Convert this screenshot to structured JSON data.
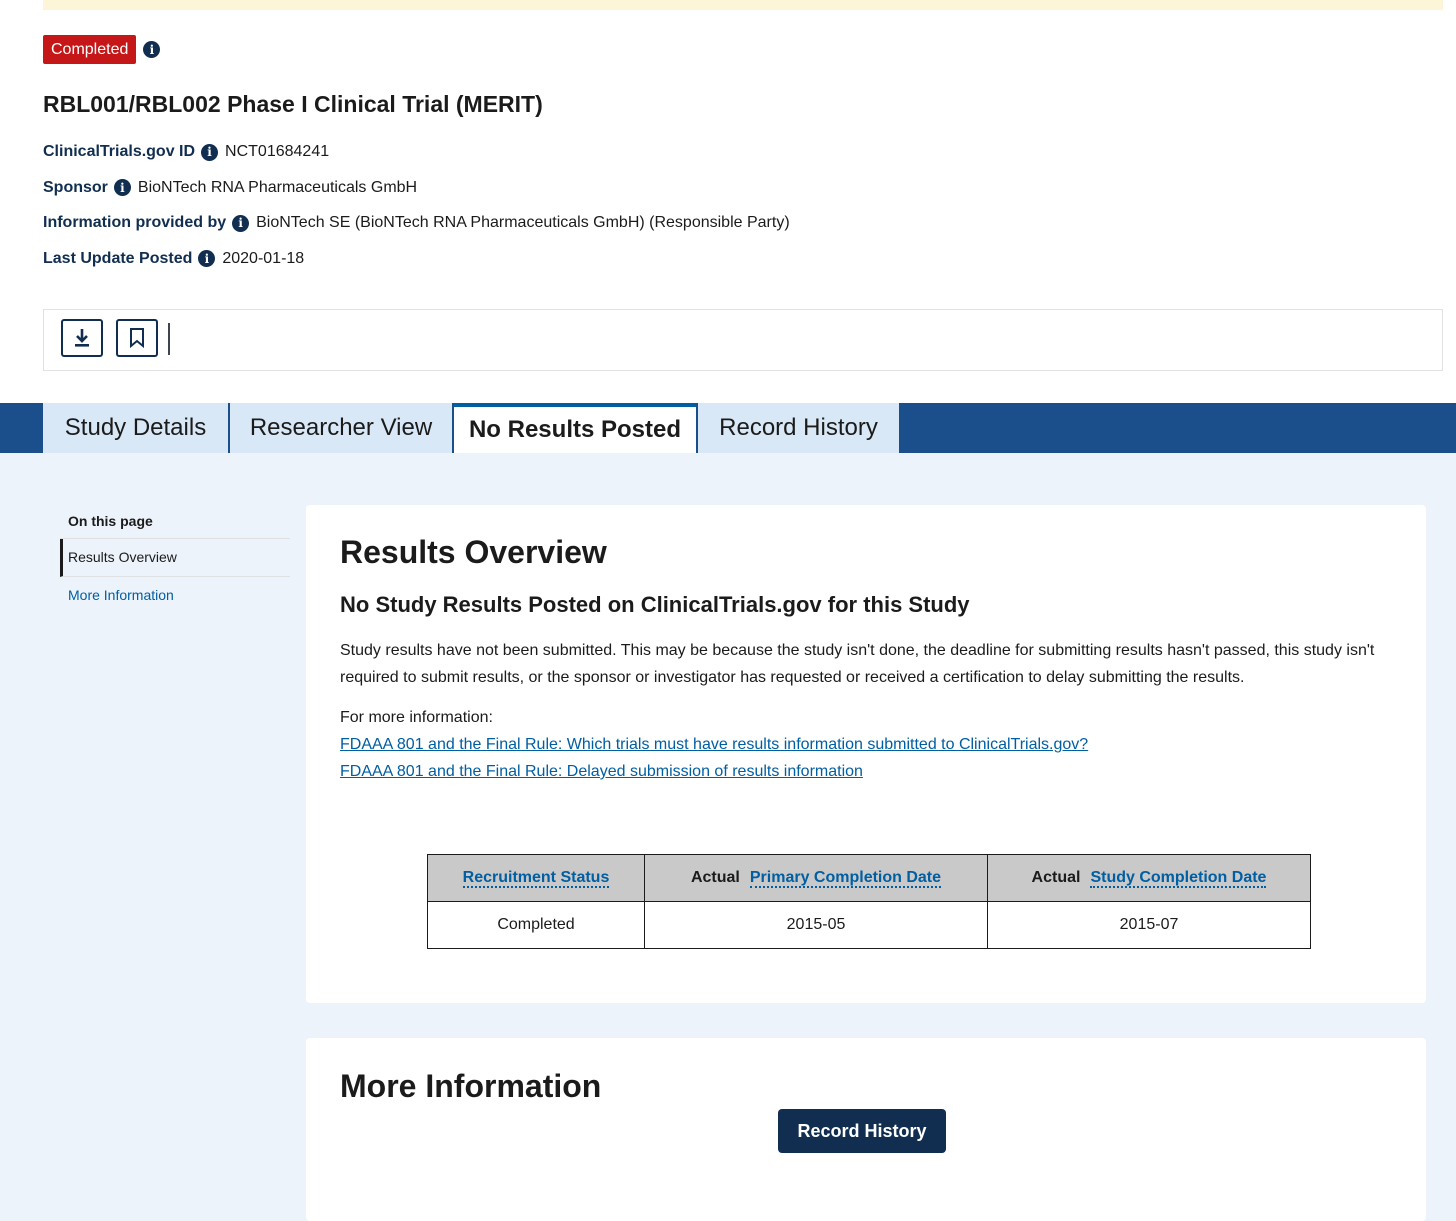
{
  "status_badge": "Completed",
  "study": {
    "title": "RBL001/RBL002 Phase I Clinical Trial (MERIT)",
    "meta": [
      {
        "label": "ClinicalTrials.gov ID",
        "value": "NCT01684241"
      },
      {
        "label": "Sponsor",
        "value": "BioNTech RNA Pharmaceuticals GmbH"
      },
      {
        "label": "Information provided by",
        "value": "BioNTech SE (BioNTech RNA Pharmaceuticals GmbH) (Responsible Party)"
      },
      {
        "label": "Last Update Posted",
        "value": "2020-01-18"
      }
    ]
  },
  "toolbar": {
    "icons": [
      "download-icon",
      "bookmark-icon"
    ]
  },
  "tabs": [
    {
      "label": "Study Details"
    },
    {
      "label": "Researcher View"
    },
    {
      "label": "No Results Posted"
    },
    {
      "label": "Record History"
    }
  ],
  "sidenav": {
    "heading": "On this page",
    "items": [
      {
        "label": "Results Overview"
      },
      {
        "label": "More Information"
      }
    ]
  },
  "results": {
    "title": "Results Overview",
    "subtitle": "No Study Results Posted on ClinicalTrials.gov for this Study",
    "body": "Study results have not been submitted. This may be because the study isn't done, the deadline for submitting results hasn't passed, this study isn't required to submit results, or the sponsor or investigator has requested or received a certification to delay submitting the results.",
    "more_info_label": "For more information:",
    "links": [
      "FDAAA 801 and the Final Rule: Which trials must have results information submitted to ClinicalTrials.gov?",
      "FDAAA 801 and the Final Rule: Delayed submission of results information"
    ],
    "table": {
      "headers": [
        {
          "prefix": "",
          "term": "Recruitment Status"
        },
        {
          "prefix": "Actual",
          "term": "Primary Completion Date"
        },
        {
          "prefix": "Actual",
          "term": "Study Completion Date"
        }
      ],
      "row": [
        "Completed",
        "2015-05",
        "2015-07"
      ]
    }
  },
  "more_information": {
    "title": "More Information",
    "button": "Record History"
  },
  "colors": {
    "badge": "#c51718",
    "navy": "#112e51",
    "tab_bar": "#1a4f8b",
    "link": "#005ea2",
    "page_bg": "#edf3fa"
  }
}
